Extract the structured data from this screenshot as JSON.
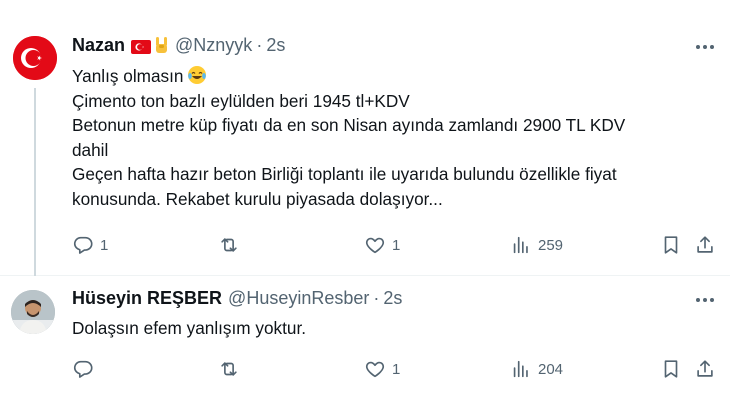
{
  "colors": {
    "text": "#0f1419",
    "muted": "#536471",
    "divider": "#eff3f4",
    "thread_line": "#cfd9de",
    "flag_red": "#e30a17"
  },
  "tweets": [
    {
      "name": "Nazan",
      "handle": "@Nznyyk",
      "separator": "·",
      "time": "2s",
      "badges": [
        "turkey-flag-icon",
        "horns-hand-icon"
      ],
      "lines": [
        "Yanlış olmasın",
        "Çimento ton bazlı eylülden beri 1945 tl+KDV",
        "Betonun metre küp fiyatı da en son Nisan ayında zamlandı 2900 TL KDV",
        "dahil",
        "Geçen hafta hazır beton Birliği toplantı ile uyarıda bulundu özellikle fiyat",
        "konusunda. Rekabet kurulu piyasada dolaşıyor..."
      ],
      "emoji": "laughing-crying-face-icon",
      "actions": {
        "replies": "1",
        "retweets": "",
        "likes": "1",
        "views": "259"
      }
    },
    {
      "name": "Hüseyin REŞBER",
      "handle": "@HuseyinResber",
      "separator": "·",
      "time": "2s",
      "lines": [
        "Dolaşsın efem yanlışım yoktur."
      ],
      "actions": {
        "replies": "",
        "retweets": "",
        "likes": "1",
        "views": "204"
      }
    }
  ]
}
